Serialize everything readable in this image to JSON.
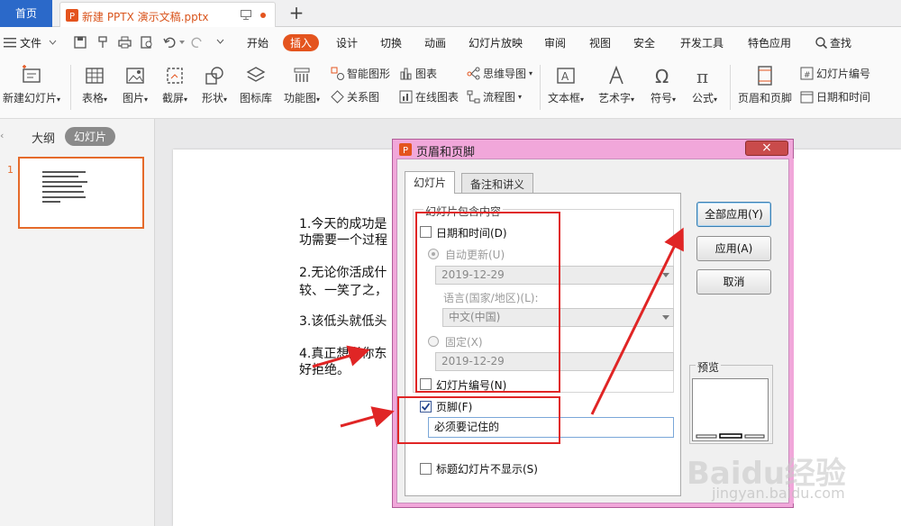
{
  "tabs": {
    "home": "首页",
    "doc": "新建 PPTX 演示文稿.pptx",
    "add": "+"
  },
  "menubar": {
    "file": "文件",
    "items": [
      "开始",
      "插入",
      "设计",
      "切换",
      "动画",
      "幻灯片放映",
      "审阅",
      "视图",
      "安全",
      "开发工具",
      "特色应用"
    ],
    "search": "查找"
  },
  "ribbon": {
    "new_slide": "新建幻灯片",
    "table": "表格",
    "picture": "图片",
    "screenshot": "截屏",
    "shape": "形状",
    "icon_lib": "图标库",
    "function_chart": "功能图",
    "smart_shape": "智能图形",
    "chart": "图表",
    "mindmap": "思维导图",
    "relation": "关系图",
    "online_chart": "在线图表",
    "flowchart": "流程图",
    "textbox": "文本框",
    "art_text": "艺术字",
    "symbol": "符号",
    "formula": "公式",
    "header_footer": "页眉和页脚",
    "slide_number": "幻灯片编号",
    "datetime": "日期和时间"
  },
  "left_panel": {
    "outline_tab": "大纲",
    "slides_tab": "幻灯片",
    "thumb_number": "1"
  },
  "slide": {
    "lines": [
      "1.今天的成功是",
      "功需要一个过程",
      "2.无论你活成什",
      "较、一笑了之，",
      "3.该低头就低头",
      "4.真正想送你东",
      "好拒绝。"
    ]
  },
  "dialog": {
    "title": "页眉和页脚",
    "close": "×",
    "tab_slide": "幻灯片",
    "tab_notes": "备注和讲义",
    "group_caption": "幻灯片包含内容",
    "datetime_label": "日期和时间(D)",
    "datetime_checked": false,
    "auto_update_label": "自动更新(U)",
    "auto_date": "2019-12-29",
    "language_label": "语言(国家/地区)(L):",
    "language_value": "中文(中国)",
    "fixed_label": "固定(X)",
    "fixed_date": "2019-12-29",
    "slide_number_label": "幻灯片编号(N)",
    "slide_number_checked": false,
    "footer_label": "页脚(F)",
    "footer_checked": true,
    "footer_value": "必须要记住的",
    "hide_on_title_label": "标题幻灯片不显示(S)",
    "hide_on_title_checked": false,
    "btn_apply_all": "全部应用(Y)",
    "btn_apply": "应用(A)",
    "btn_cancel": "取消",
    "preview_label": "预览"
  },
  "watermark": {
    "text": "Baidu经验",
    "url": "jingyan.baidu.com"
  },
  "colors": {
    "accent": "#e4541e",
    "home_tab": "#2b69c9",
    "dialog_frame": "#f1a7da",
    "annotation": "#e02525"
  }
}
